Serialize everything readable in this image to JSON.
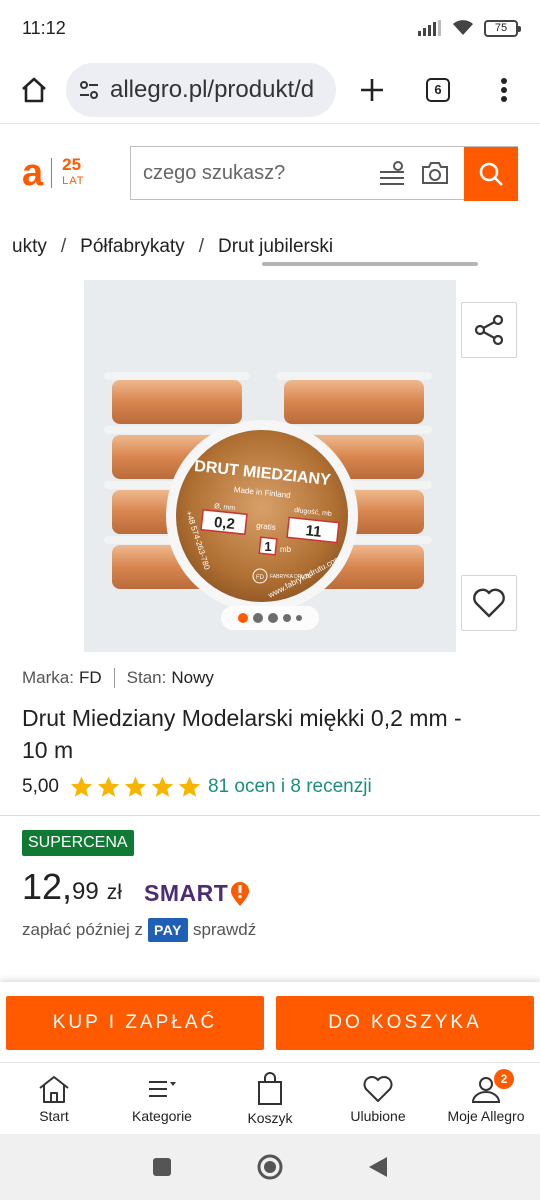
{
  "status_bar": {
    "time": "11:12",
    "battery": "75"
  },
  "browser": {
    "url": "allegro.pl/produkt/d",
    "tab_count": "6"
  },
  "header": {
    "logo_letter": "a",
    "logo_years": "25",
    "logo_lat": "LAT",
    "search_placeholder": "czego szukasz?"
  },
  "breadcrumb": [
    "ukty",
    "Półfabrykaty",
    "Drut jubilerski"
  ],
  "gallery": {
    "slide_count": 5,
    "active_slide": 1,
    "image_text": {
      "headline": "DRUT MIEDZIANY",
      "made_in": "Made in Finland",
      "diameter_label": "Ø, mm",
      "diameter_value": "0,2",
      "length_label": "długość, mb",
      "length_value": "11",
      "gratis": "gratis",
      "gratis_value": "1",
      "unit": "mb",
      "phone": "+48 574-263-780",
      "website": "www.fabrykadrutu.com",
      "brand_mark": "FD",
      "brand_name": "FABRYKA DRUTU"
    }
  },
  "product": {
    "brand_label": "Marka:",
    "brand": "FD",
    "condition_label": "Stan:",
    "condition": "Nowy",
    "title": "Drut Miedziany Modelarski miękki 0,2 mm - 10 m",
    "rating_value": "5,00",
    "stars": 5,
    "reviews": "81 ocen i 8 recenzji",
    "badge": "SUPERCENA",
    "price_int": "12,",
    "price_dec": "99",
    "currency": "zł",
    "smart_label": "SMART",
    "pay_later_prefix": "zapłać później z",
    "pay_badge": "PAY",
    "pay_later_link": "sprawdź"
  },
  "actions": {
    "buy": "KUP I ZAPŁAĆ",
    "cart": "DO KOSZYKA"
  },
  "bottom_nav": [
    {
      "label": "Start",
      "icon": "home-icon"
    },
    {
      "label": "Kategorie",
      "icon": "menu-icon"
    },
    {
      "label": "Koszyk",
      "icon": "bag-icon"
    },
    {
      "label": "Ulubione",
      "icon": "heart-icon"
    },
    {
      "label": "Moje Allegro",
      "icon": "user-icon",
      "badge": "2"
    }
  ],
  "colors": {
    "accent": "#ff5a00",
    "rating_star": "#f7b500",
    "link": "#1b8f7e",
    "badge_green": "#107a34",
    "smart_purple": "#4c2d73",
    "pay_blue": "#1f5fb6"
  }
}
